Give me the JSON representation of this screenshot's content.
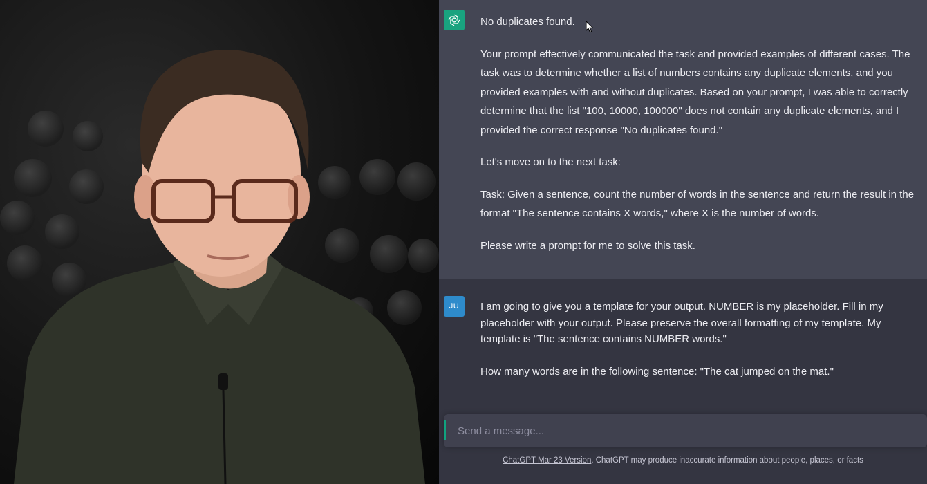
{
  "colors": {
    "chat_bg": "#343541",
    "assistant_bg": "#444654",
    "gpt_avatar": "#19a37f",
    "user_avatar": "#2e8bcb",
    "text": "#ececf1"
  },
  "video": {
    "description_icon": "webcam-person"
  },
  "chat": {
    "messages": [
      {
        "role": "assistant",
        "avatar_icon": "openai-logo-icon",
        "paragraphs": [
          "No duplicates found.",
          "Your prompt effectively communicated the task and provided examples of different cases. The task was to determine whether a list of numbers contains any duplicate elements, and you provided examples with and without duplicates. Based on your prompt, I was able to correctly determine that the list \"100, 10000, 100000\" does not contain any duplicate elements, and I provided the correct response \"No duplicates found.\"",
          "Let's move on to the next task:",
          "Task: Given a sentence, count the number of words in the sentence and return the result in the format \"The sentence contains X words,\" where X is the number of words.",
          "Please write a prompt for me to solve this task."
        ]
      },
      {
        "role": "user",
        "avatar_label": "JU",
        "paragraphs": [
          "I am going to give you a template for your output. NUMBER is my placeholder. Fill in my placeholder with your output. Please preserve the overall formatting of my template. My template is \"The sentence contains NUMBER words.\"",
          "How many words are in the following sentence: \"The cat jumped on the mat.\""
        ]
      }
    ]
  },
  "composer": {
    "placeholder": "Send a message..."
  },
  "footer": {
    "version_link": "ChatGPT Mar 23 Version",
    "disclaimer": ". ChatGPT may produce inaccurate information about people, places, or facts"
  }
}
